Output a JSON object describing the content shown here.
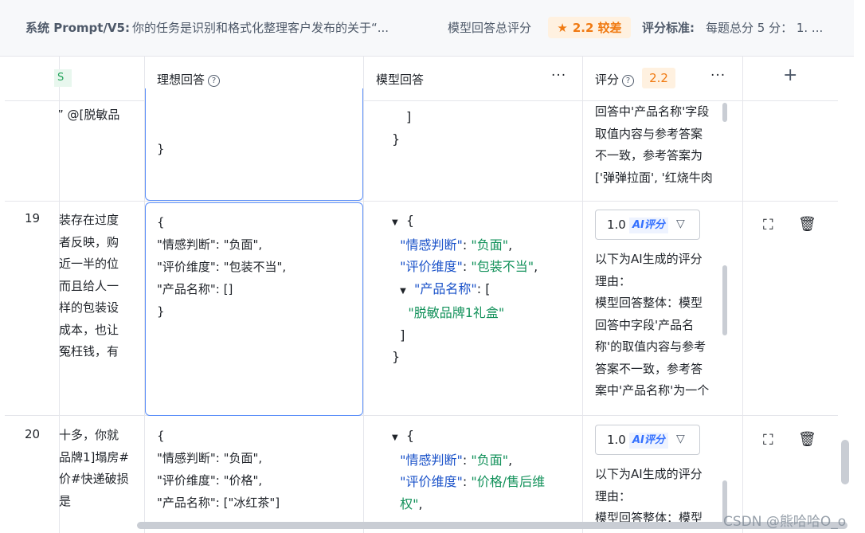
{
  "topbar": {
    "system_label": "系统 Prompt/V5:",
    "system_text": "你的任务是识别和格式化整理客户发布的关于“...",
    "score_label": "模型回答总评分",
    "score_value": "2.2 较差",
    "standard_label": "评分标准:",
    "standard_text": "每题总分 5 分： 1. ...",
    "badge_color": "#f07a12"
  },
  "columns": {
    "partial_tag": "S",
    "ideal": "理想回答",
    "model": "模型回答",
    "score": "评分",
    "score_avg": "2.2",
    "more": "···",
    "add": "+"
  },
  "rows": [
    {
      "number": "",
      "question_lines": [
        "” @[脱敏品"
      ],
      "ideal_lines": [
        "}"
      ],
      "model_lines": [
        "]",
        "}"
      ],
      "reason_lines": [
        "回答中'产品名称'字段",
        "取值内容与参考答案",
        "不一致，参考答案为",
        "['弹弹拉面', '红烧牛肉"
      ]
    },
    {
      "number": "19",
      "question_lines": [
        "装存在过度",
        "者反映，购",
        "近一半的位",
        "而且给人一",
        "样的包装设",
        "成本，也让",
        "冤枉钱，有"
      ],
      "ideal_lines": [
        "{",
        "\"情感判断\": \"负面\",",
        "\"评价维度\": \"包装不当\",",
        "\"产品名称\": []",
        "}"
      ],
      "model": {
        "k1": "\"情感判断\"",
        "v1": "\"负面\"",
        "k2": "\"评价维度\"",
        "v2": "\"包装不当\"",
        "k3": "\"产品名称\"",
        "item": "\"脱敏品牌1礼盒\""
      },
      "score": "1.0",
      "ai_tag": "AI评分",
      "reason_lines": [
        "以下为AI生成的评分",
        "理由：",
        "模型回答整体：模型",
        "回答中字段'产品名",
        "称'的取值内容与参考",
        "答案不一致，参考答",
        "案中'产品名称'为一个"
      ]
    },
    {
      "number": "20",
      "question_lines": [
        "十多，你就",
        "品牌1]塌房#",
        "价#快递破损",
        "是"
      ],
      "ideal_lines": [
        "{",
        "\"情感判断\": \"负面\",",
        "\"评价维度\": \"价格\",",
        "\"产品名称\": [\"冰红茶\"]"
      ],
      "model": {
        "k1": "\"情感判断\"",
        "v1": "\"负面\"",
        "k2": "\"评价维度\"",
        "v2a": "\"价格/售后维",
        "v2b": "权\""
      },
      "score": "1.0",
      "ai_tag": "AI评分",
      "reason_lines": [
        "以下为AI生成的评分",
        "理由：",
        "模型回答整体：模型"
      ]
    }
  ],
  "watermark": "CSDN @熊哈哈O_o"
}
